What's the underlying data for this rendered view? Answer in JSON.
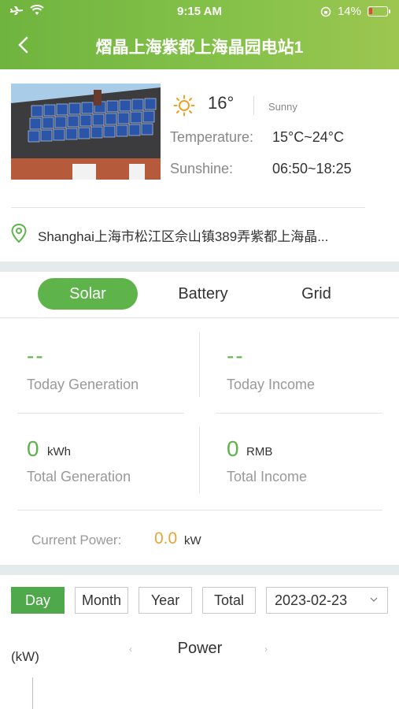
{
  "status_bar": {
    "time": "9:15 AM",
    "battery": "14%"
  },
  "header": {
    "title": "熠晶上海紫都上海晶园电站1"
  },
  "weather": {
    "temperature_now": "16°",
    "condition": "Sunny",
    "temperature_label": "Temperature:",
    "temperature_range": "15°C~24°C",
    "sunshine_label": "Sunshine:",
    "sunshine_range": "06:50~18:25"
  },
  "location": {
    "address": "Shanghai上海市松江区佘山镇389弄紫都上海晶..."
  },
  "tabs": [
    {
      "label": "Solar",
      "active": true
    },
    {
      "label": "Battery",
      "active": false
    },
    {
      "label": "Grid",
      "active": false
    }
  ],
  "stats": {
    "today_generation": {
      "value": "--",
      "label": "Today Generation"
    },
    "today_income": {
      "value": "--",
      "label": "Today Income"
    },
    "total_generation": {
      "value": "0",
      "unit": "kWh",
      "label": "Total Generation"
    },
    "total_income": {
      "value": "0",
      "unit": "RMB",
      "label": "Total Income"
    },
    "current_power": {
      "label": "Current Power:",
      "value": "0.0",
      "unit": "kW"
    }
  },
  "period_buttons": [
    {
      "label": "Day",
      "active": true
    },
    {
      "label": "Month",
      "active": false
    },
    {
      "label": "Year",
      "active": false
    },
    {
      "label": "Total",
      "active": false
    }
  ],
  "date_selector": {
    "value": "2023-02-23"
  },
  "chart": {
    "title": "Power",
    "y_unit": "(kW)",
    "prev": "‹",
    "next": "›"
  },
  "colors": {
    "brand_green": "#5eb44a",
    "header_green": "#86c24a",
    "power_orange": "#e8a33a"
  }
}
